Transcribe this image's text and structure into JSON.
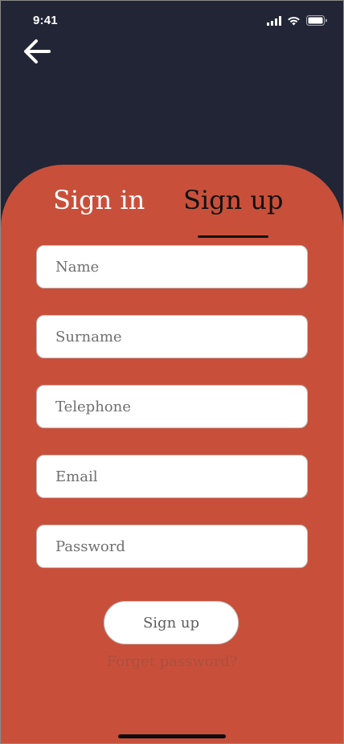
{
  "status_bar": {
    "time": "9:41",
    "icons": [
      "cellular-signal-icon",
      "wifi-icon",
      "battery-icon"
    ]
  },
  "header": {
    "back_icon": "arrow-left-icon"
  },
  "tabs": {
    "sign_in_label": "Sign in",
    "sign_up_label": "Sign up",
    "active": "sign_up"
  },
  "form": {
    "fields": [
      {
        "placeholder": "Name",
        "value": ""
      },
      {
        "placeholder": "Surname",
        "value": ""
      },
      {
        "placeholder": "Telephone",
        "value": ""
      },
      {
        "placeholder": "Email",
        "value": ""
      },
      {
        "placeholder": "Password",
        "value": ""
      }
    ],
    "submit_label": "Sign up",
    "forgot_password_label": "Forget password?"
  },
  "colors": {
    "background": "#222535",
    "card": "#c8503b",
    "active_tab": "#111111",
    "inactive_tab": "#ffffff"
  }
}
